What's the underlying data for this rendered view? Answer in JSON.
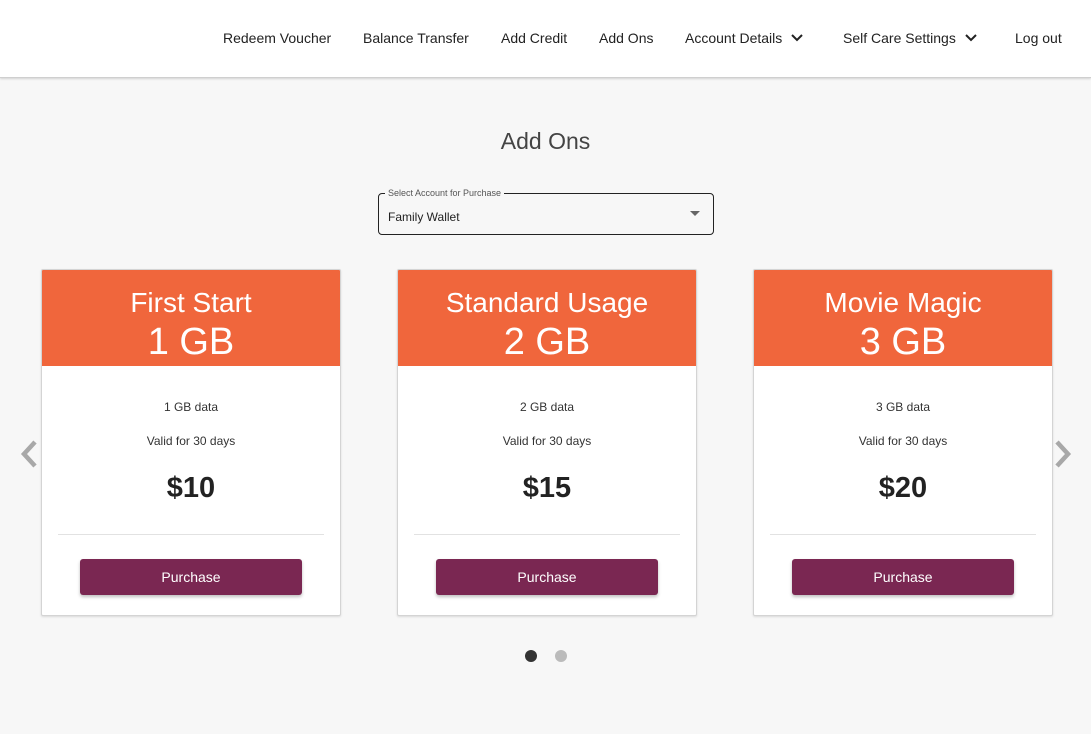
{
  "nav": {
    "items": [
      {
        "label": "Redeem Voucher",
        "dropdown": false
      },
      {
        "label": "Balance Transfer",
        "dropdown": false
      },
      {
        "label": "Add Credit",
        "dropdown": false
      },
      {
        "label": "Add Ons",
        "dropdown": false
      },
      {
        "label": "Account Details",
        "dropdown": true
      },
      {
        "label": "Self Care Settings",
        "dropdown": true
      },
      {
        "label": "Log out",
        "dropdown": false
      }
    ]
  },
  "page": {
    "title": "Add Ons"
  },
  "account_select": {
    "label": "Select Account for Purchase",
    "value": "Family Wallet"
  },
  "plans": [
    {
      "name": "First Start",
      "size": "1 GB",
      "data": "1 GB data",
      "validity": "Valid for 30 days",
      "price": "$10",
      "button": "Purchase"
    },
    {
      "name": "Standard Usage",
      "size": "2 GB",
      "data": "2 GB data",
      "validity": "Valid for 30 days",
      "price": "$15",
      "button": "Purchase"
    },
    {
      "name": "Movie Magic",
      "size": "3 GB",
      "data": "3 GB data",
      "validity": "Valid for 30 days",
      "price": "$20",
      "button": "Purchase"
    }
  ],
  "carousel": {
    "prev_icon": "chevron-left-icon",
    "next_icon": "chevron-right-icon",
    "current_page": 1,
    "total_pages": 2
  },
  "colors": {
    "card_header": "#f0663c",
    "purchase_button": "#7a2752",
    "dot_active": "#333333",
    "dot_inactive": "#bbbbbb"
  }
}
